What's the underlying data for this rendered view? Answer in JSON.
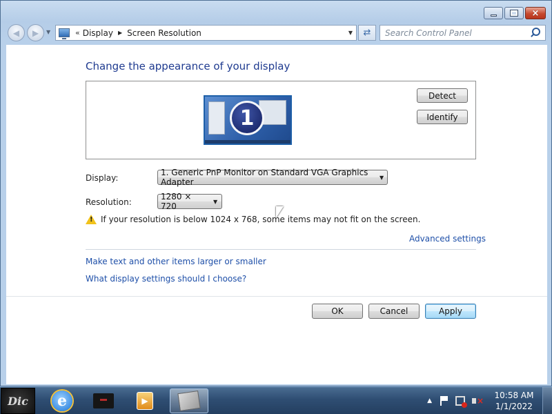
{
  "window": {
    "caption": {
      "minimize": "–",
      "maximize": "□",
      "close": "×"
    }
  },
  "nav": {
    "breadcrumb_chevron": "«",
    "breadcrumb": [
      "Display",
      "Screen Resolution"
    ],
    "search_placeholder": "Search Control Panel"
  },
  "main": {
    "title": "Change the appearance of your display",
    "monitor_number": "1",
    "detect_label": "Detect",
    "identify_label": "Identify",
    "display_label": "Display:",
    "display_value": "1. Generic PnP Monitor on Standard VGA Graphics Adapter",
    "resolution_label": "Resolution:",
    "resolution_value": "1280 × 720",
    "warning_text": "If your resolution is below 1024 x 768, some items may not fit on the screen.",
    "advanced_link": "Advanced settings",
    "link_larger": "Make text and other items larger or smaller",
    "link_help": "What display settings should I choose?"
  },
  "buttons": {
    "ok": "OK",
    "cancel": "Cancel",
    "apply": "Apply"
  },
  "taskbar": {
    "start_text": "Dic",
    "clock_time": "10:58 AM",
    "clock_date": "1/1/2022",
    "items": [
      "internet-explorer-icon",
      "folder-icon",
      "media-player-icon",
      "display-settings-icon"
    ]
  },
  "colors": {
    "link": "#1e4fa8",
    "title": "#1e3a8f",
    "taskbar": "#2f4e73"
  }
}
